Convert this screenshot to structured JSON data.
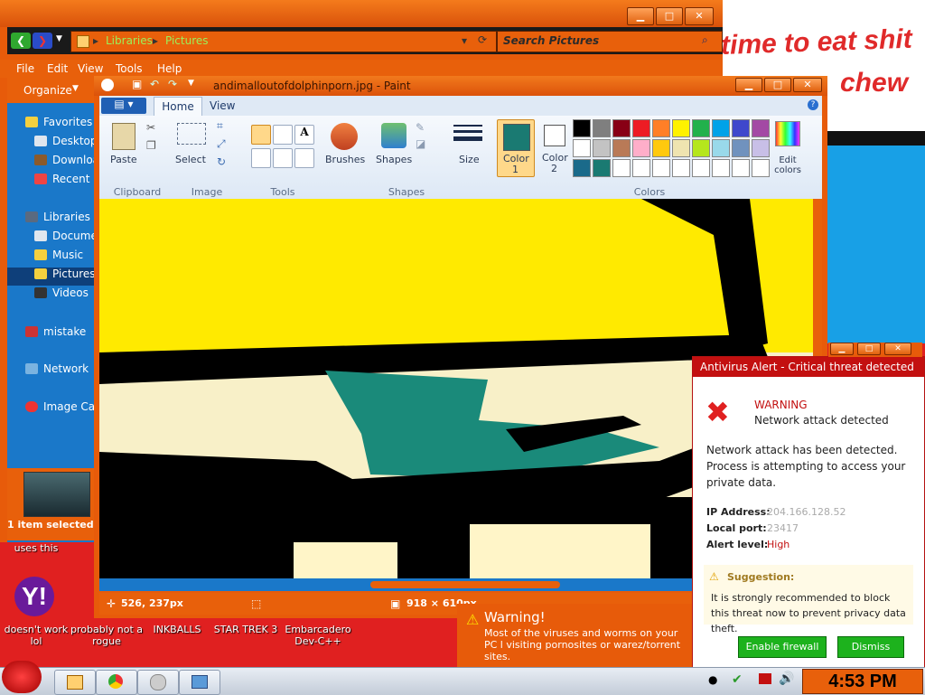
{
  "comic": {
    "line1": "time to eat shit",
    "line2": "chew"
  },
  "explorer": {
    "breadcrumb": [
      "Libraries",
      "Pictures"
    ],
    "search_placeholder": "Search Pictures",
    "menu": [
      "File",
      "Edit",
      "View",
      "Tools",
      "Help"
    ],
    "organize": "Organize",
    "nav": {
      "favorites": "Favorites",
      "fav_items": [
        "Desktop",
        "Downloads",
        "Recent Places"
      ],
      "libraries": "Libraries",
      "lib_items": [
        "Documents",
        "Music",
        "Pictures",
        "Videos"
      ],
      "mistake": "mistake",
      "network": "Network",
      "imagecat": "Image Catalog"
    },
    "status": "1 item selected"
  },
  "paint": {
    "title": "andimalloutofdolphinporn.jpg - Paint",
    "tabs": [
      "Home",
      "View"
    ],
    "groups": [
      "Clipboard",
      "Image",
      "Tools",
      "Shapes",
      "Colors"
    ],
    "labels": {
      "paste": "Paste",
      "select": "Select",
      "brushes": "Brushes",
      "shapes": "Shapes",
      "size": "Size",
      "color1": "Color",
      "color1_num": "1",
      "color2": "Color",
      "color2_num": "2",
      "edit_colors": "Edit colors"
    },
    "colors": {
      "color1": "#1a7a72",
      "color2": "#ffffff",
      "palette_row1": [
        "#000000",
        "#7f7f7f",
        "#880015",
        "#ed1c24",
        "#ff7f27",
        "#fff200",
        "#22b14c",
        "#00a2e8",
        "#3f48cc",
        "#a349a4"
      ],
      "palette_row2": [
        "#ffffff",
        "#c3c3c3",
        "#b97a57",
        "#ffaec9",
        "#ffc90e",
        "#efe4b0",
        "#b5e61d",
        "#99d9ea",
        "#7092be",
        "#c8bfe7"
      ],
      "palette_row3": [
        "#1a6a8a",
        "#1a7a72"
      ]
    },
    "status": {
      "position": "526, 237px",
      "size": "918 × 610px"
    }
  },
  "antivirus": {
    "title": "Antivirus Alert - Critical threat detected",
    "warning": "WARNING",
    "warning_sub": "Network attack detected",
    "body": "Network attack has been detected. Process is attempting to access your private data.",
    "ip_label": "IP Address:",
    "ip_value": "204.166.128.52",
    "port_label": "Local port:",
    "port_value": "23417",
    "level_label": "Alert level:",
    "level_value": "High",
    "suggestion_title": "Suggestion:",
    "suggestion": "It is strongly recommended to block this threat now to prevent privacy data theft.",
    "enable_btn": "Enable firewall",
    "dismiss_btn": "Dismiss"
  },
  "warning_balloon": {
    "title": "Warning!",
    "text": "Most of the viruses and worms on your PC l visiting pornosites or warez/torrent sites."
  },
  "desktop": {
    "uses_this": "uses this",
    "icons": [
      "doesn't work lol",
      "probably not a rogue",
      "INKBALLS",
      "STAR TREK 3",
      "Embarcadero Dev-C++"
    ]
  },
  "taskbar": {
    "clock": "4:53 PM"
  }
}
